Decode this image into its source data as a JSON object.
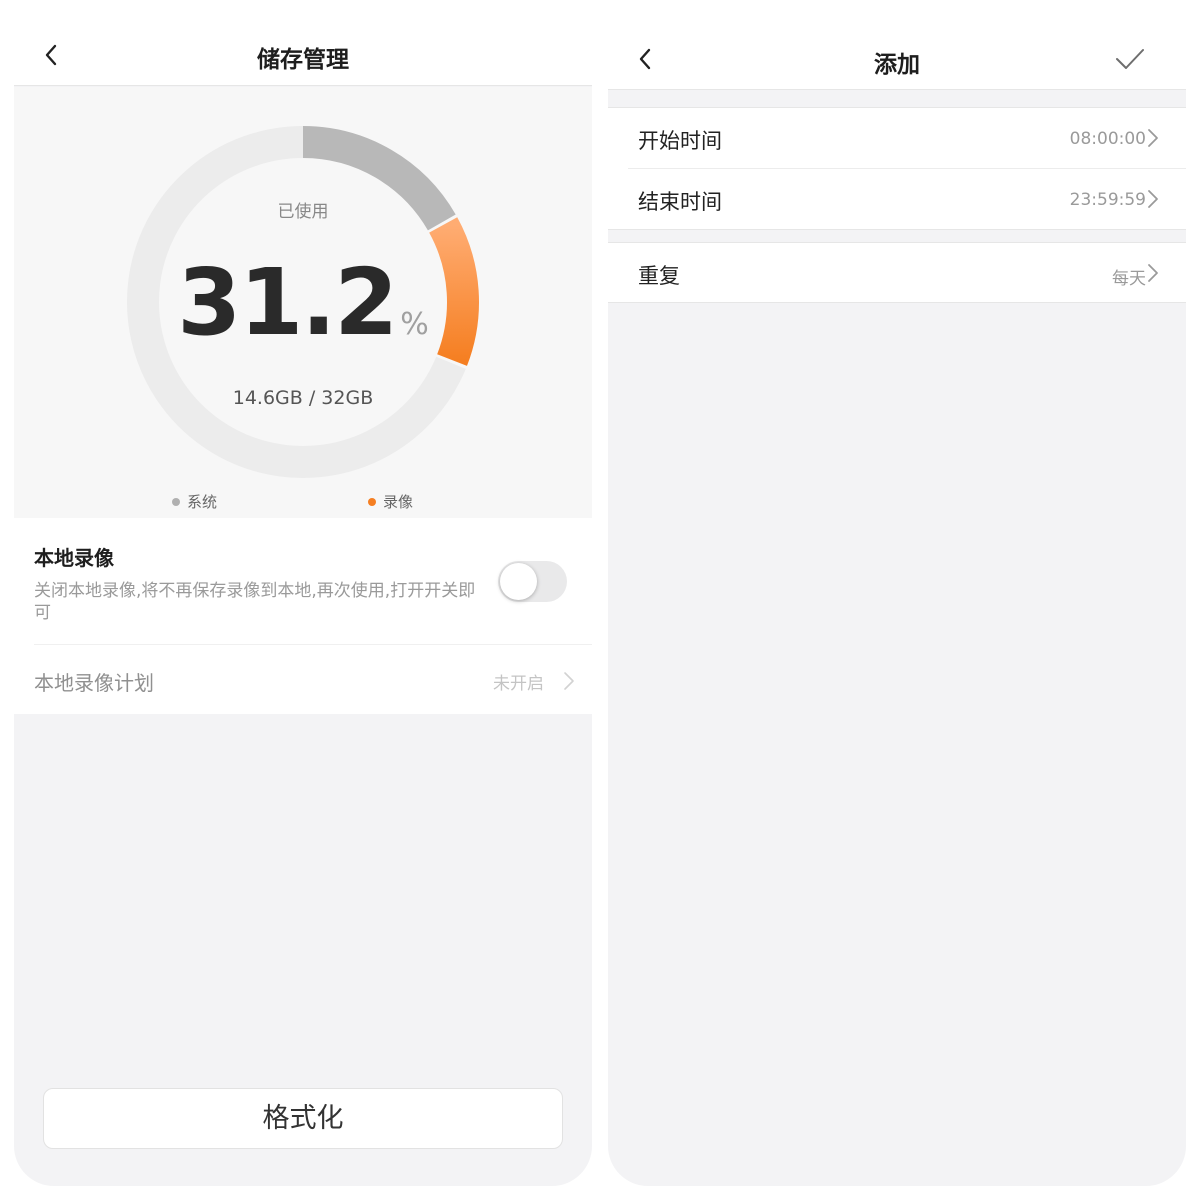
{
  "left_screen": {
    "header": {
      "title": "储存管理"
    },
    "storage": {
      "used_label": "已使用",
      "percent": "31.2",
      "percent_unit": "%",
      "capacity": "14.6GB / 32GB",
      "legend": [
        {
          "label": "系统",
          "color": "#b0b0b0"
        },
        {
          "label": "录像",
          "color": "#f57f22"
        }
      ]
    },
    "chart_data": {
      "type": "pie",
      "style": "donut",
      "slices": [
        {
          "label": "系统",
          "fraction": 0.17,
          "color": "#b8b8b8"
        },
        {
          "label": "录像",
          "fraction": 0.142,
          "color": "#f57f22",
          "gradient_start": "#ffac72"
        },
        {
          "label": "",
          "fraction": 0.688,
          "color": "#ececec"
        }
      ]
    },
    "local_record": {
      "title": "本地录像",
      "description": "关闭本地录像,将不再保存录像到本地,再次使用,打开开关即可",
      "toggle_on": false
    },
    "schedule": {
      "label": "本地录像计划",
      "value": "未开启"
    },
    "format_button": "格式化"
  },
  "right_screen": {
    "header": {
      "title": "添加"
    },
    "rows": [
      {
        "label": "开始时间",
        "value": "08:00:00"
      },
      {
        "label": "结束时间",
        "value": "23:59:59"
      },
      {
        "label": "重复",
        "value": "每天"
      }
    ]
  },
  "icons": {
    "back": "chevron-left-icon",
    "confirm": "checkmark-icon",
    "row_arrow": "chevron-right-icon"
  }
}
